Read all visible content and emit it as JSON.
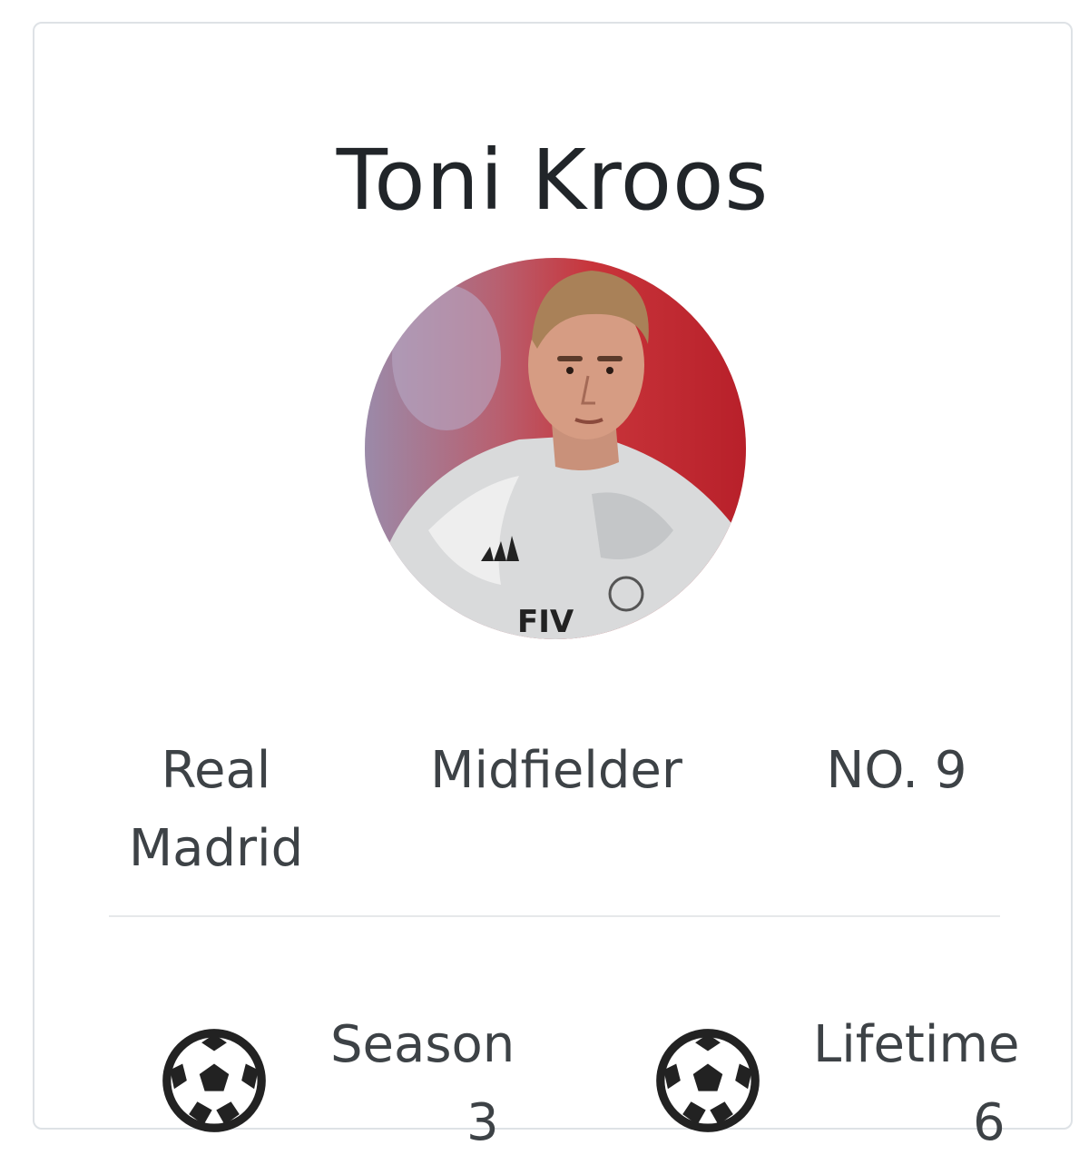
{
  "player": {
    "name": "Toni Kroos",
    "club": "Real Madrid",
    "position": "Midfielder",
    "number": "NO. 9",
    "photo_icon": "player-photo"
  },
  "stats": {
    "season_label": "Season",
    "season_value": "3",
    "lifetime_label": "Lifetime",
    "lifetime_value": "6",
    "icon": "soccer-ball-icon"
  },
  "colors": {
    "text": "#212529",
    "muted_text": "#3d4246",
    "border": "#dee2e6"
  }
}
